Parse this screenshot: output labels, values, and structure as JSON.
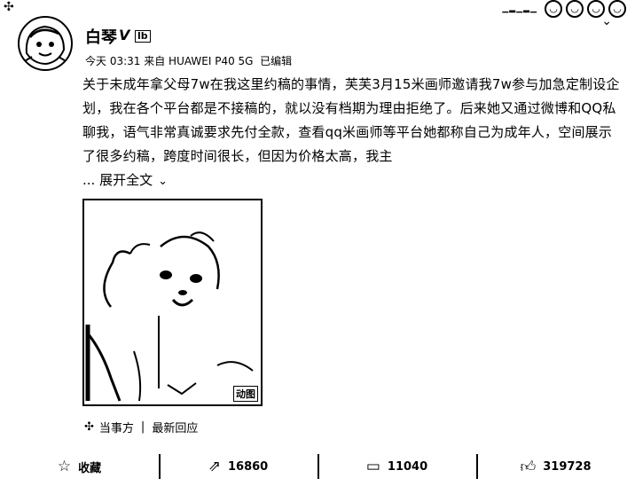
{
  "post": {
    "author": "白琴",
    "verified": "V",
    "level_badge": "lb",
    "timestamp": "今天 03:31",
    "source": "来自 HUAWEI P40 5G",
    "edited": "已编辑",
    "text": "关于未成年拿父母7w在我这里约稿的事情，芙芙3月15米画师邀请我7w参与加急定制设企划，我在各个平台都是不接稿的，就以没有档期为理由拒绝了。后来她又通过微博和QQ私聊我，语气非常真诚要求先付全款，查看qq米画师等平台她都称自己为成年人，空间展示了很多约稿，跨度时间很长，但因为价格太高，我主",
    "expand_label": "... 展开全文",
    "image_badge": "动图"
  },
  "topic": {
    "label": "当事方",
    "latest": "最新回应"
  },
  "actions": {
    "favorite": "收藏",
    "repost_count": "16860",
    "comment_count": "11040",
    "like_count": "319728"
  }
}
